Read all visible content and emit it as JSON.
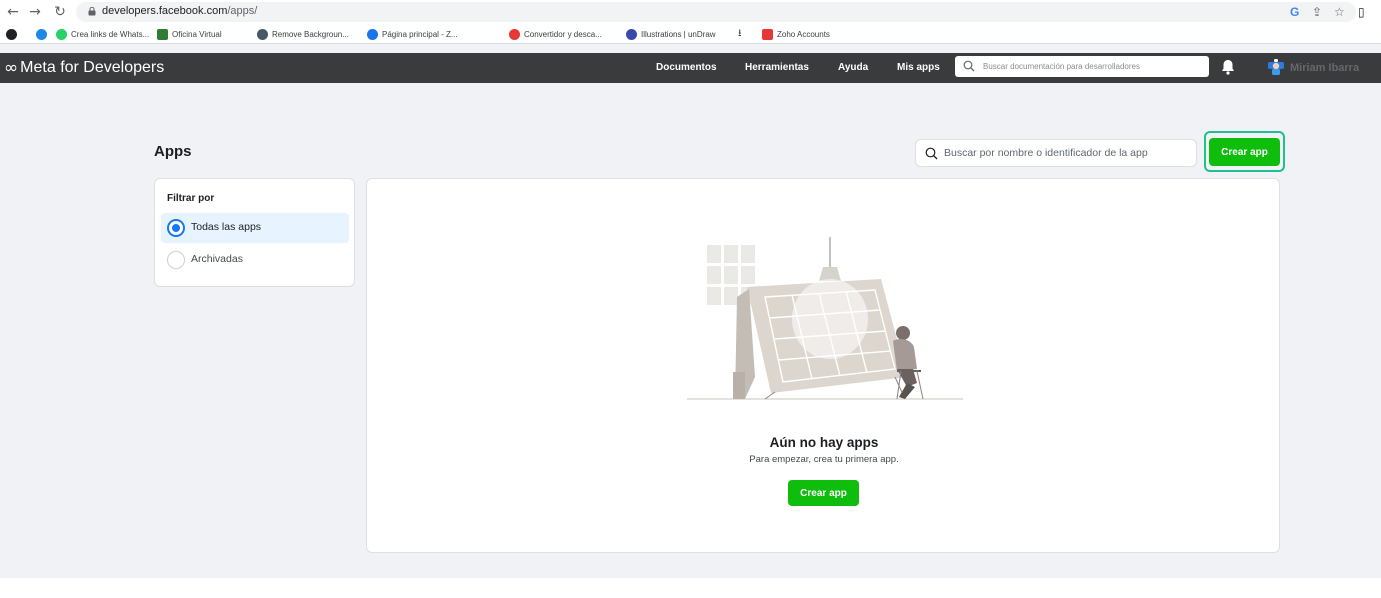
{
  "browser": {
    "url_domain": "developers.facebook.com",
    "url_path": "/apps/",
    "bookmarks": [
      {
        "label": "Crea links de Whats...",
        "icon": "whatsapp-link-icon",
        "color": "#25d366"
      },
      {
        "label": "Oficina Virtual",
        "icon": "oficina-icon",
        "color": "#2e7d32"
      },
      {
        "label": "Remove Backgroun...",
        "icon": "remove-bg-icon",
        "color": "#455a64"
      },
      {
        "label": "Página principal - Z...",
        "icon": "zoho-icon",
        "color": "#1a73e8"
      },
      {
        "label": "Convertidor y desca...",
        "icon": "converter-icon",
        "color": "#e53935"
      },
      {
        "label": "Illustrations | unDraw",
        "icon": "undraw-icon",
        "color": "#3949ab"
      },
      {
        "label": "Zoho Accounts",
        "icon": "zoho-accounts-icon",
        "color": "#e53935"
      }
    ]
  },
  "header": {
    "brand": "Meta for Developers",
    "nav": [
      "Documentos",
      "Herramientas",
      "Ayuda",
      "Mis apps"
    ],
    "search_placeholder": "Buscar documentación para desarrolladores",
    "user_name": "Miriam Ibarra"
  },
  "page": {
    "title": "Apps",
    "search_placeholder": "Buscar por nombre o identificador de la app",
    "create_label": "Crear app"
  },
  "filters": {
    "title": "Filtrar por",
    "options": [
      {
        "label": "Todas las apps",
        "selected": true
      },
      {
        "label": "Archivadas",
        "selected": false
      }
    ]
  },
  "empty_state": {
    "title": "Aún no hay apps",
    "subtitle": "Para empezar, crea tu primera app.",
    "button": "Crear app"
  },
  "colors": {
    "header_bg": "#3a3b3c",
    "accent_green": "#0fbd0c",
    "focus_ring": "#1fbf91",
    "radio_blue": "#1877f2",
    "page_bg": "#f0f2f5"
  }
}
